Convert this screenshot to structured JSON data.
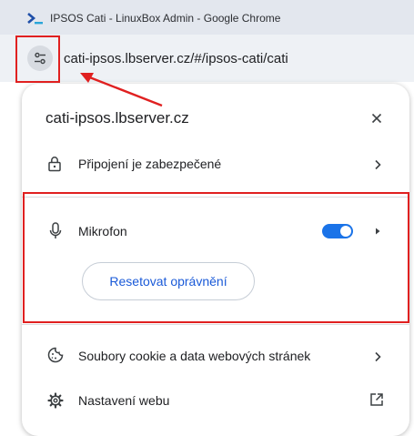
{
  "window": {
    "title": "IPSOS Cati - LinuxBox Admin - Google Chrome"
  },
  "address_bar": {
    "url": "cati-ipsos.lbserver.cz/#/ipsos-cati/cati",
    "site_info_icon": "tune-icon"
  },
  "popup": {
    "site": "cati-ipsos.lbserver.cz",
    "connection": {
      "label": "Připojení je zabezpečené",
      "icon": "lock-icon"
    },
    "permissions": [
      {
        "label": "Mikrofon",
        "icon": "microphone-icon",
        "enabled": true
      }
    ],
    "reset_button": "Resetovat oprávnění",
    "cookies": {
      "label": "Soubory cookie a data webových stránek",
      "icon": "cookie-icon"
    },
    "site_settings": {
      "label": "Nastavení webu",
      "icon": "gear-icon",
      "trailing_icon": "open-external-icon"
    }
  },
  "colors": {
    "toggle_on": "#1a73e8",
    "annotation": "#e02020",
    "link_blue": "#1a5ad8"
  }
}
